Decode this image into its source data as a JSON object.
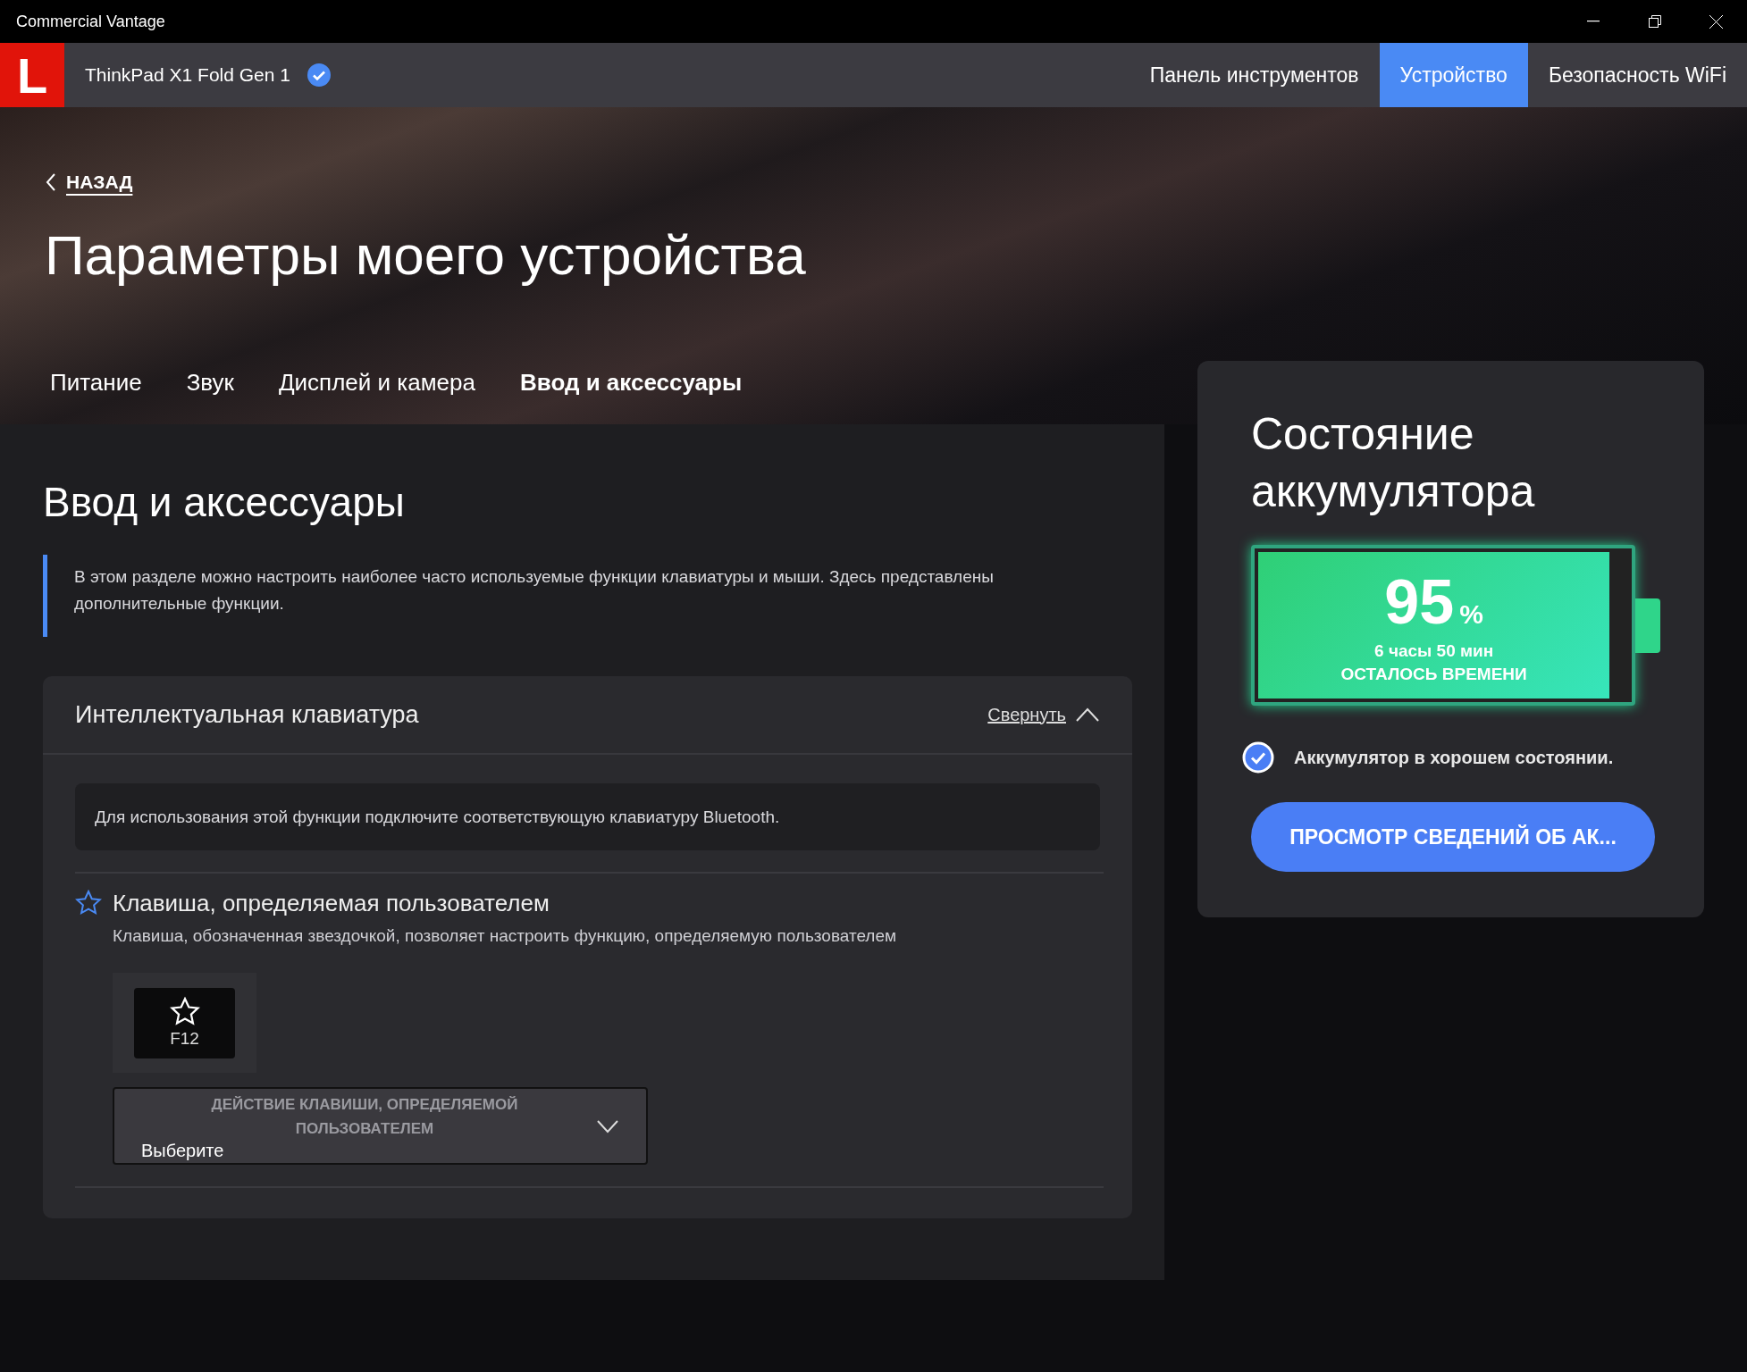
{
  "window": {
    "title": "Commercial Vantage"
  },
  "header": {
    "logo": "L",
    "device": "ThinkPad X1 Fold Gen 1",
    "verified": true,
    "nav": [
      {
        "label": "Панель инструментов",
        "selected": false
      },
      {
        "label": "Устройство",
        "selected": true
      },
      {
        "label": "Безопасность WiFi",
        "selected": false
      }
    ]
  },
  "back_link": "НАЗАД",
  "page_title": "Параметры моего устройства",
  "subtabs": [
    {
      "label": "Питание",
      "selected": false
    },
    {
      "label": "Звук",
      "selected": false
    },
    {
      "label": "Дисплей и камера",
      "selected": false
    },
    {
      "label": "Ввод и аксессуары",
      "selected": true
    }
  ],
  "section": {
    "title": "Ввод и аксессуары",
    "description": "В этом разделе можно настроить наиболее часто используемые функции клавиатуры и мыши. Здесь представлены дополнительные функции."
  },
  "panel": {
    "title": "Интеллектуальная клавиатура",
    "collapse_link": "Свернуть",
    "expanded": true,
    "notice": "Для использования этой функции подключите соответствующую клавиатуру Bluetooth.",
    "feature": {
      "title": "Клавиша, определяемая пользователем",
      "subtitle": "Клавиша, обозначенная звездочкой, позволяет настроить функцию, определяемую пользователем",
      "key_label": "F12",
      "dropdown": {
        "label": "ДЕЙСТВИЕ КЛАВИШИ, ОПРЕДЕЛЯЕМОЙ ПОЛЬЗОВАТЕЛЕМ",
        "value": "Выберите"
      }
    }
  },
  "battery": {
    "title": "Состояние аккумулятора",
    "level": 0.95,
    "percent": "95",
    "percent_sign": "%",
    "time": "6 часы 50 мин",
    "time_label": "ОСТАЛОСЬ ВРЕМЕНИ",
    "healthy": true,
    "health_text": "Аккумулятор в хорошем состоянии.",
    "button": "ПРОСМОТР СВЕДЕНИЙ ОБ АК..."
  }
}
